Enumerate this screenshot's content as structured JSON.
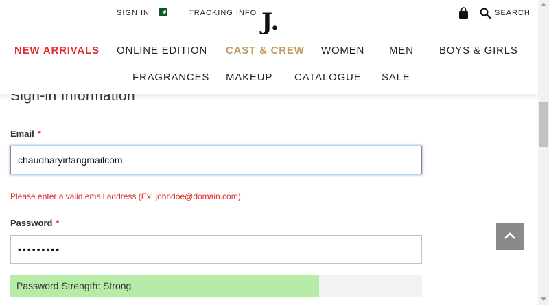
{
  "header": {
    "sign_in": "SIGN IN",
    "tracking": "TRACKING INFO",
    "logo": "J.",
    "search": "SEARCH",
    "flag_icon": "pakistan-flag-icon",
    "bag_icon": "shopping-bag-icon",
    "search_icon": "search-icon"
  },
  "nav": {
    "row1": [
      "NEW ARRIVALS",
      "ONLINE EDITION",
      "CAST & CREW",
      "WOMEN",
      "MEN",
      "BOYS & GIRLS"
    ],
    "row2": [
      "FRAGRANCES",
      "MAKEUP",
      "CATALOGUE",
      "SALE"
    ],
    "accent_red": "#e8262c",
    "accent_gold": "#c29b5e"
  },
  "form": {
    "section_title": "Sign-in Information",
    "email_label": "Email",
    "required_mark": "*",
    "email_value": "chaudharyirfangmailcom",
    "email_error": "Please enter a valid email address (Ex: johndoe@domain.com).",
    "password_label": "Password",
    "password_value": "*********",
    "strength_text": "Password Strength: Strong",
    "strength_fraction": 0.75,
    "strength_color": "#b7eba8"
  },
  "back_to_top_icon": "chevron-up-icon"
}
